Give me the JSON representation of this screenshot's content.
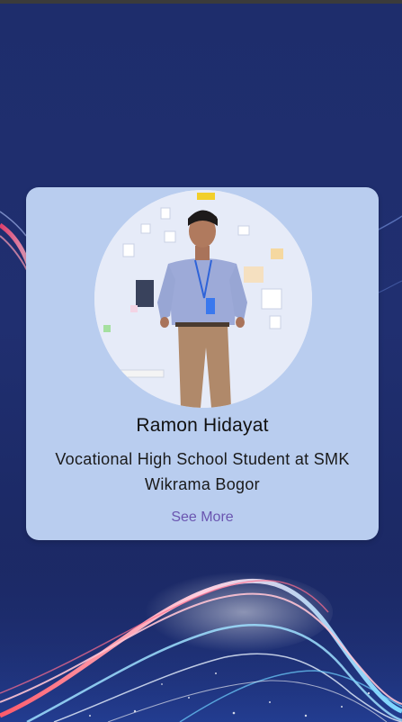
{
  "profile": {
    "name": "Ramon Hidayat",
    "role": "Vocational High School Student at SMK Wikrama Bogor",
    "see_more_label": "See More"
  },
  "colors": {
    "background": "#1e2d6c",
    "card": "#b9cdef",
    "link": "#6a55b0"
  },
  "icons": {
    "avatar": "profile-photo"
  }
}
